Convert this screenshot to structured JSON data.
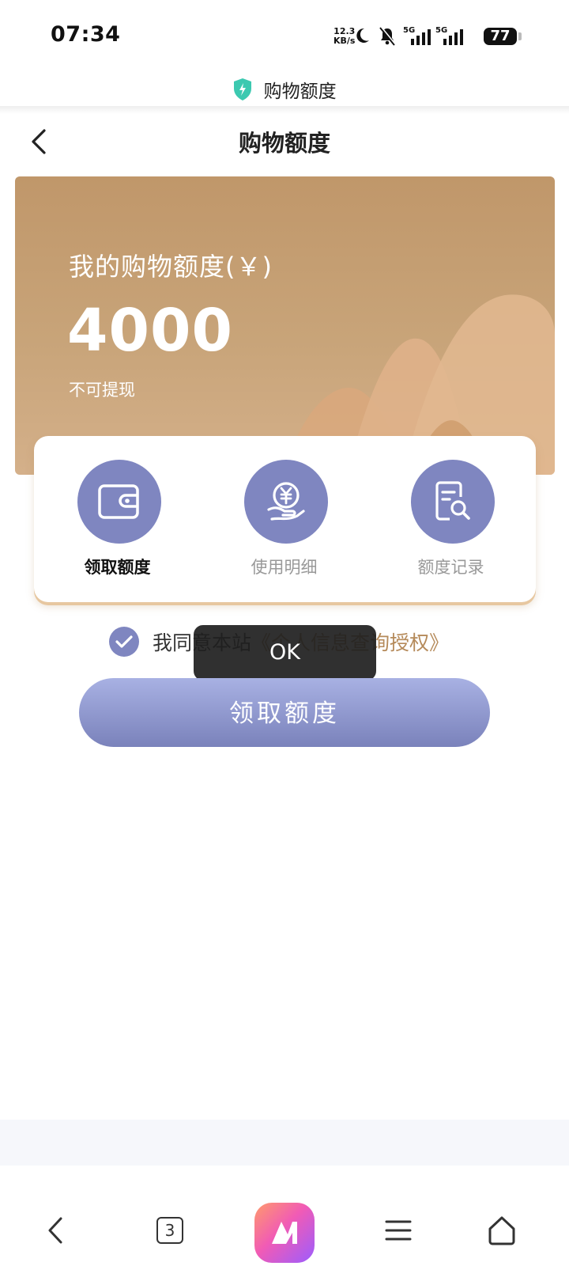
{
  "status_bar": {
    "time": "07:34",
    "net_speed_value": "12.3",
    "net_speed_unit": "KB/s",
    "signal_labels": [
      "5G",
      "5G"
    ],
    "battery": "77"
  },
  "browser": {
    "site_title": "购物额度",
    "tab_count": "3"
  },
  "header": {
    "title": "购物额度"
  },
  "banner": {
    "label": "我的购物额度(￥)",
    "amount": "4000",
    "note": "不可提现"
  },
  "actions": [
    {
      "label": "领取额度",
      "icon": "wallet-icon",
      "active": true
    },
    {
      "label": "使用明细",
      "icon": "yen-hand-icon",
      "active": false
    },
    {
      "label": "额度记录",
      "icon": "document-search-icon",
      "active": false
    }
  ],
  "agreement": {
    "prefix": "我同意本站",
    "link": "《个人信息查询授权》",
    "checked": true
  },
  "toast": {
    "text": "OK"
  },
  "primary_button": {
    "label": "领取额度"
  },
  "colors": {
    "accent": "#7f86c0",
    "banner": "#c8a479",
    "link": "#b58a5a"
  }
}
